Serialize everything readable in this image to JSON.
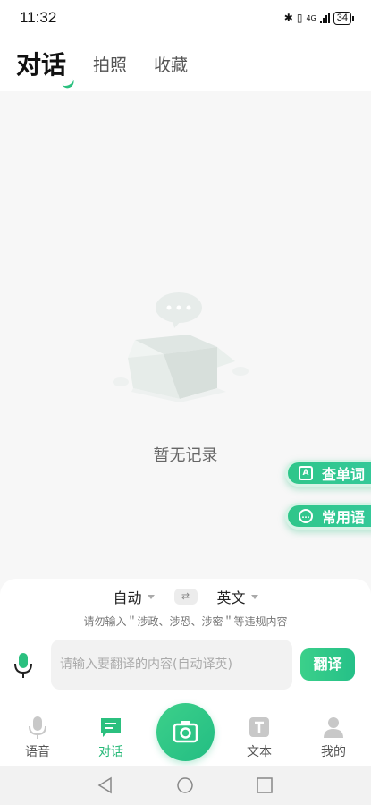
{
  "status_bar": {
    "time": "11:32",
    "network": "4G",
    "battery": "34"
  },
  "top_tabs": [
    {
      "label": "对话",
      "active": true
    },
    {
      "label": "拍照",
      "active": false
    },
    {
      "label": "收藏",
      "active": false
    }
  ],
  "empty_state": {
    "text": "暂无记录",
    "icon": "empty-box-icon"
  },
  "float_buttons": {
    "lookup_word": "查单词",
    "common_phrases": "常用语"
  },
  "translator": {
    "source_lang": "自动",
    "target_lang": "英文",
    "warning": "请勿输入＂涉政、涉恐、涉密＂等违规内容",
    "input_placeholder": "请输入要翻译的内容(自动译英)",
    "input_value": "",
    "translate_label": "翻译"
  },
  "bottom_nav": [
    {
      "label": "语音",
      "icon": "mic-icon",
      "active": false
    },
    {
      "label": "对话",
      "icon": "chat-icon",
      "active": true
    },
    {
      "label": "",
      "icon": "camera-icon",
      "active": false
    },
    {
      "label": "文本",
      "icon": "text-icon",
      "active": false
    },
    {
      "label": "我的",
      "icon": "person-icon",
      "active": false
    }
  ],
  "colors": {
    "accent": "#2bc07f",
    "background": "#f7f7f7"
  }
}
